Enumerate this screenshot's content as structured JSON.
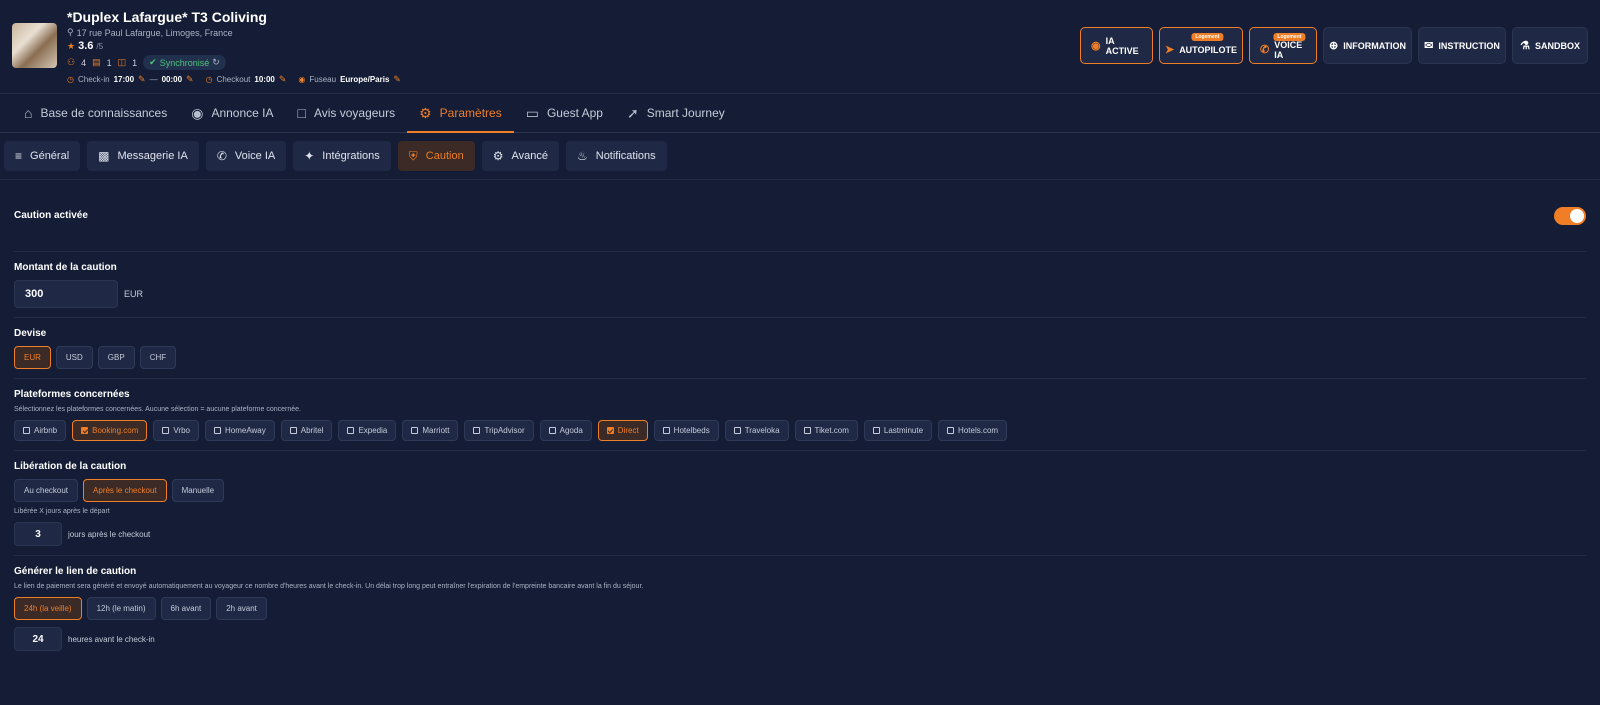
{
  "header": {
    "title": "*Duplex Lafargue* T3 Coliving",
    "address": "17 rue Paul Lafargue, Limoges, France",
    "rating": "3.6",
    "rating_max": "/5",
    "guests": "4",
    "beds": "1",
    "baths": "1",
    "sync_label": "Synchronisé",
    "checkin_label": "Check-in",
    "checkin_time": "17:00",
    "checkin_end": "00:00",
    "checkout_label": "Checkout",
    "checkout_time": "10:00",
    "timezone_label": "Fuseau",
    "timezone": "Europe/Paris"
  },
  "actions": {
    "ia_active": "IA ACTIVE",
    "autopilote": "AUTOPILOTE",
    "autopilote_tag": "Logement",
    "voice_ia": "VOICE IA",
    "voice_tag": "Logement",
    "information": "INFORMATION",
    "instruction": "INSTRUCTION",
    "sandbox": "SANDBOX"
  },
  "tabs": [
    {
      "label": "Base de connaissances"
    },
    {
      "label": "Annonce IA"
    },
    {
      "label": "Avis voyageurs"
    },
    {
      "label": "Paramètres"
    },
    {
      "label": "Guest App"
    },
    {
      "label": "Smart Journey"
    }
  ],
  "subtabs": [
    {
      "label": "Général"
    },
    {
      "label": "Messagerie IA"
    },
    {
      "label": "Voice IA"
    },
    {
      "label": "Intégrations"
    },
    {
      "label": "Caution"
    },
    {
      "label": "Avancé"
    },
    {
      "label": "Notifications"
    }
  ],
  "caution": {
    "enabled_label": "Caution activée",
    "amount_label": "Montant de la caution",
    "amount_value": "300",
    "amount_unit": "EUR",
    "currency_label": "Devise",
    "currencies": [
      "EUR",
      "USD",
      "GBP",
      "CHF"
    ],
    "platforms_label": "Plateformes concernées",
    "platforms_desc": "Sélectionnez les plateformes concernées. Aucune sélection = aucune plateforme concernée.",
    "platforms": [
      "Airbnb",
      "Booking.com",
      "Vrbo",
      "HomeAway",
      "Abritel",
      "Expedia",
      "Marriott",
      "TripAdvisor",
      "Agoda",
      "Direct",
      "Hotelbeds",
      "Traveloka",
      "Tiket.com",
      "Lastminute",
      "Hotels.com"
    ],
    "release_label": "Libération de la caution",
    "release_options": [
      "Au checkout",
      "Après le checkout",
      "Manuelle"
    ],
    "release_desc": "Libérée X jours après le départ",
    "release_days": "3",
    "release_days_unit": "jours après le checkout",
    "link_label": "Générer le lien de caution",
    "link_desc": "Le lien de paiement sera généré et envoyé automatiquement au voyageur ce nombre d'heures avant le check-in. Un délai trop long peut entraîner l'expiration de l'empreinte bancaire avant la fin du séjour.",
    "link_options": [
      "24h (la veille)",
      "12h (le matin)",
      "6h avant",
      "2h avant"
    ],
    "link_hours": "24",
    "link_hours_unit": "heures avant le check-in"
  },
  "colors": {
    "accent": "#f07e26",
    "background": "#141d35",
    "panel": "#1f2945",
    "sync_green": "#4fc37a"
  }
}
